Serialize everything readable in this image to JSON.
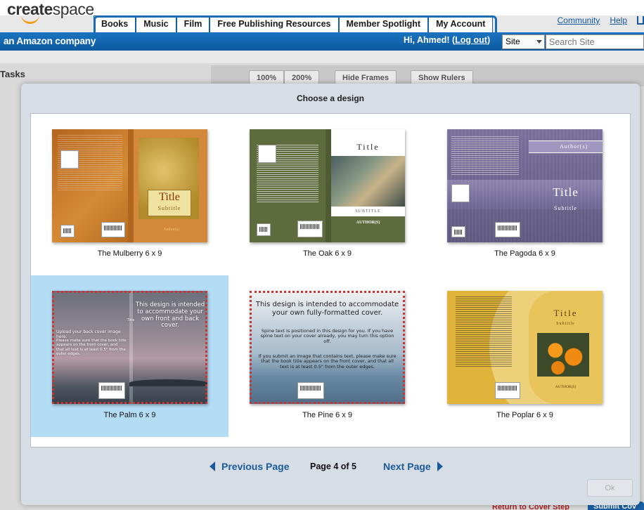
{
  "header": {
    "logo_main": "create",
    "logo_space": "space",
    "tagline": "an Amazon company",
    "nav_tabs": [
      "Books",
      "Music",
      "Film",
      "Free Publishing Resources",
      "Member Spotlight",
      "My Account"
    ],
    "top_links": [
      "Community",
      "Help"
    ],
    "greeting": "Hi, Ahmed! (",
    "logout": "Log out",
    "greeting_end": ")",
    "site_select": "Site",
    "search_placeholder": "Search Site"
  },
  "background": {
    "tasks": "Tasks",
    "toolbar": [
      "100%",
      "200%",
      "Hide Frames",
      "Show Rulers"
    ],
    "bottom_link": "Return to Cover Step",
    "bottom_button": "Submit Cov"
  },
  "modal": {
    "title": "Choose a design",
    "designs": [
      {
        "label": "The Mulberry 6 x 9",
        "cover_title": "Title",
        "cover_subtitle": "Subtitle",
        "author": "Author(s)"
      },
      {
        "label": "The Oak 6 x 9",
        "cover_title": "Title",
        "cover_subtitle": "SUBTITLE",
        "author": "AUTHOR(S)"
      },
      {
        "label": "The Pagoda 6 x 9",
        "cover_title": "Title",
        "cover_subtitle": "Subtitle",
        "author": "Author(s)"
      },
      {
        "label": "The Palm 6 x 9",
        "spine": "Title",
        "front_msg": "This design is intended to accommodate your own front and back cover.",
        "back_msg": "Upload your back cover image here.",
        "back_note": "Please make sure that the book title appears on the front cover, and that all text is at least 0.5\" from the outer edges."
      },
      {
        "label": "The Pine 6 x 9",
        "headline": "This design is intended to accommodate your own fully-formatted cover.",
        "spine_msg": "Spine text is positioned in this design for you. If you have spine text on your cover already, you may turn this option off.",
        "note": "If you submit an image that contains text, please make sure that the book title appears on the front cover, and that all text is at least 0.5\" from the outer edges."
      },
      {
        "label": "The Poplar 6 x 9",
        "cover_title": "Title",
        "cover_subtitle": "Subtitle",
        "author": "AUTHOR(S)"
      }
    ],
    "selected_index": 3,
    "pagination": {
      "prev": "Previous Page",
      "page_info": "Page 4 of 5",
      "next": "Next Page"
    },
    "ok": "Ok"
  },
  "colors": {
    "brand_blue": "#0f61a8",
    "link_blue": "#1c5b99",
    "selected_bg": "#b3dcf5",
    "logo_orange": "#f39c12"
  }
}
